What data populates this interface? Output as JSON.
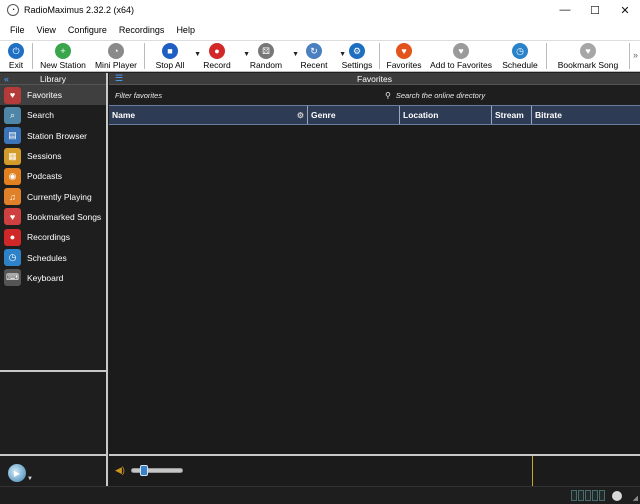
{
  "window": {
    "title": "RadioMaximus 2.32.2 (x64)",
    "min": "—",
    "max": "☐",
    "close": "✕"
  },
  "menu": [
    "File",
    "View",
    "Configure",
    "Recordings",
    "Help"
  ],
  "toolbar": [
    {
      "label": "Exit",
      "icon": "power-icon",
      "glyph": "⏻",
      "color": "#1f6fc4"
    },
    {
      "label": "New Station",
      "icon": "add-icon",
      "glyph": "+",
      "color": "#3aa54a"
    },
    {
      "label": "Mini Player",
      "icon": "mini-player-icon",
      "glyph": "◔",
      "color": "#8a8a8a"
    },
    {
      "label": "Stop All",
      "icon": "stop-icon",
      "glyph": "■",
      "color": "#1f5fc4",
      "dropdown": true
    },
    {
      "label": "Record",
      "icon": "record-icon",
      "glyph": "●",
      "color": "#d22828",
      "dropdown": true
    },
    {
      "label": "Random",
      "icon": "dice-icon",
      "glyph": "⚄",
      "color": "#777",
      "dropdown": true
    },
    {
      "label": "Recent",
      "icon": "refresh-icon",
      "glyph": "↻",
      "color": "#4b7fbf",
      "dropdown": true
    },
    {
      "label": "Settings",
      "icon": "gear-icon",
      "glyph": "⚙",
      "color": "#1e6fc1"
    },
    {
      "label": "Favorites",
      "icon": "heart-icon",
      "glyph": "♥",
      "color": "#e2541b"
    },
    {
      "label": "Add to Favorites",
      "icon": "add-heart-icon",
      "glyph": "♥",
      "color": "#9a9a9a"
    },
    {
      "label": "Schedule",
      "icon": "clock-icon",
      "glyph": "◷",
      "color": "#2a83c9"
    },
    {
      "label": "Bookmark Song",
      "icon": "bookmark-heart-icon",
      "glyph": "♥",
      "color": "#a6a6a6"
    }
  ],
  "toolbar_overflow": "»",
  "library": {
    "title": "Library",
    "collapse_glyph": "«",
    "items": [
      {
        "label": "Favorites",
        "icon": "heart-icon",
        "glyph": "♥",
        "color": "#b53a3a",
        "active": true
      },
      {
        "label": "Search",
        "icon": "search-icon",
        "glyph": "⌕",
        "color": "#4f86a8"
      },
      {
        "label": "Station Browser",
        "icon": "browser-icon",
        "glyph": "▤",
        "color": "#3b74b8"
      },
      {
        "label": "Sessions",
        "icon": "sessions-icon",
        "glyph": "▦",
        "color": "#d39a2c"
      },
      {
        "label": "Podcasts",
        "icon": "podcast-icon",
        "glyph": "◉",
        "color": "#e08020"
      },
      {
        "label": "Currently Playing",
        "icon": "music-icon",
        "glyph": "♫",
        "color": "#e0812a"
      },
      {
        "label": "Bookmarked Songs",
        "icon": "bookmark-heart-icon",
        "glyph": "♥",
        "color": "#cf4040"
      },
      {
        "label": "Recordings",
        "icon": "record-icon",
        "glyph": "●",
        "color": "#d02828"
      },
      {
        "label": "Schedules",
        "icon": "clock-icon",
        "glyph": "◷",
        "color": "#2d82c8"
      },
      {
        "label": "Keyboard",
        "icon": "keyboard-icon",
        "glyph": "⌨",
        "color": "#555"
      }
    ]
  },
  "panel": {
    "title": "Favorites",
    "menu_glyph": "☰",
    "filter_placeholder": "Filter favorites",
    "search_placeholder": "Search the online directory",
    "search_glyph": "🔍",
    "columns": [
      {
        "label": "Name",
        "has_gear": true
      },
      {
        "label": "Genre"
      },
      {
        "label": "Location"
      },
      {
        "label": "Stream"
      },
      {
        "label": "Bitrate"
      }
    ],
    "rows": []
  },
  "player": {
    "volume_glyph": "🔈",
    "volume_level": 0.2,
    "control_glyph": "▶",
    "dropdown_glyph": "▼"
  },
  "status": {
    "grip": "◢"
  }
}
